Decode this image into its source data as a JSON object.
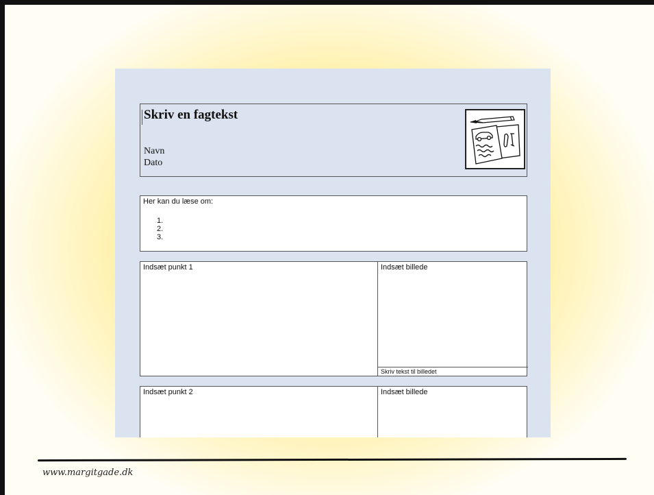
{
  "document": {
    "title": "Skriv en fagtekst",
    "name_label": "Navn",
    "date_label": "Dato",
    "intro_heading": "Her kan du læse om:",
    "intro_list": [
      "1.",
      "2.",
      "3."
    ],
    "section1": {
      "label": "Indsæt punkt 1",
      "image_label": "Indsæt billede",
      "caption": "Skriv tekst til billedet"
    },
    "section2": {
      "label": "Indsæt punkt 2",
      "image_label": "Indsæt billede"
    },
    "header_icon": "pencil-papers-icon"
  },
  "footer": {
    "url": "www.margitgade.dk"
  }
}
